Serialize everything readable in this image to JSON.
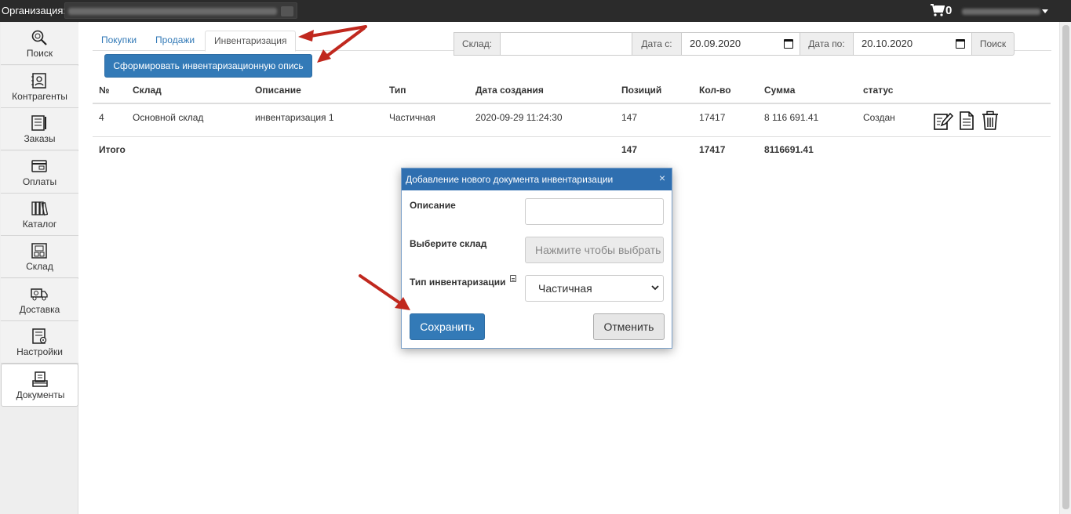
{
  "topbar": {
    "org_label": "Организация:",
    "cart_count": "0"
  },
  "sidebar": {
    "items": [
      {
        "label": "Поиск",
        "icon": "search-icon"
      },
      {
        "label": "Контрагенты",
        "icon": "contacts-icon"
      },
      {
        "label": "Заказы",
        "icon": "orders-icon"
      },
      {
        "label": "Оплаты",
        "icon": "payments-icon"
      },
      {
        "label": "Каталог",
        "icon": "catalog-icon"
      },
      {
        "label": "Склад",
        "icon": "warehouse-icon"
      },
      {
        "label": "Доставка",
        "icon": "delivery-icon"
      },
      {
        "label": "Настройки",
        "icon": "settings-icon"
      },
      {
        "label": "Документы",
        "icon": "documents-icon"
      }
    ],
    "active": "Документы"
  },
  "tabs": [
    {
      "label": "Покупки"
    },
    {
      "label": "Продажи"
    },
    {
      "label": "Инвентаризация",
      "active": true
    }
  ],
  "actions": {
    "create_inventory": "Сформировать инвентаризационную опись"
  },
  "filters": {
    "warehouse_label": "Склад:",
    "warehouse_value": "",
    "date_from_label": "Дата с:",
    "date_from_value": "20.09.2020",
    "date_to_label": "Дата по:",
    "date_to_value": "20.10.2020",
    "search_button": "Поиск"
  },
  "table": {
    "columns": [
      "№",
      "Склад",
      "Описание",
      "Тип",
      "Дата создания",
      "Позиций",
      "Кол-во",
      "Сумма",
      "статус"
    ],
    "rows": [
      {
        "num": "4",
        "warehouse": "Основной склад",
        "description": "инвентаризация 1",
        "type": "Частичная",
        "created": "2020-09-29 11:24:30",
        "positions": "147",
        "qty": "17417",
        "sum": "8 116 691.41",
        "status": "Создан"
      }
    ],
    "total": {
      "label": "Итого",
      "positions": "147",
      "qty": "17417",
      "sum": "8116691.41"
    }
  },
  "modal": {
    "title": "Добавление нового документа инвентаризации",
    "close": "×",
    "description_label": "Описание",
    "description_value": "",
    "warehouse_label": "Выберите склад",
    "warehouse_placeholder": "Нажмите чтобы выбрать",
    "type_label": "Тип инвентаризации",
    "type_value": "Частичная",
    "save_button": "Сохранить",
    "cancel_button": "Отменить"
  },
  "colors": {
    "primary": "#337ab7",
    "topbar": "#2b2b2b",
    "modal_header": "#2f6fb0",
    "annotation_arrow": "#c0281e"
  }
}
